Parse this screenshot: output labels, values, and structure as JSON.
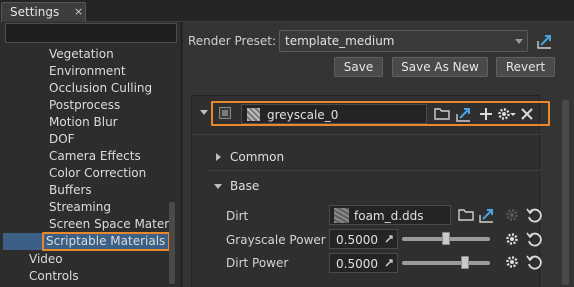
{
  "window": {
    "tab_title": "Settings",
    "tab_close": "×"
  },
  "left_panel": {
    "search_value": "",
    "tree": [
      {
        "label": "Vegetation",
        "level": 1
      },
      {
        "label": "Environment",
        "level": 1
      },
      {
        "label": "Occlusion Culling",
        "level": 1
      },
      {
        "label": "Postprocess",
        "level": 1
      },
      {
        "label": "Motion Blur",
        "level": 1
      },
      {
        "label": "DOF",
        "level": 1
      },
      {
        "label": "Camera Effects",
        "level": 1
      },
      {
        "label": "Color Correction",
        "level": 1
      },
      {
        "label": "Buffers",
        "level": 1
      },
      {
        "label": "Streaming",
        "level": 1
      },
      {
        "label": "Screen Space Mater...",
        "level": 1
      },
      {
        "label": "Scriptable Materials",
        "level": 1,
        "selected": true
      },
      {
        "label": "Video",
        "level": 0
      },
      {
        "label": "Controls",
        "level": 0
      }
    ]
  },
  "right_panel": {
    "render_preset_label": "Render Preset:",
    "render_preset_value": "template_medium",
    "buttons": {
      "save": "Save",
      "save_as_new": "Save As New",
      "revert": "Revert"
    },
    "material": {
      "name": "greyscale_0",
      "enabled": false,
      "groups": {
        "common": "Common",
        "base": "Base"
      },
      "params": {
        "dirt_label": "Dirt",
        "dirt_value": "foam_d.dds",
        "grayscale_power_label": "Grayscale Power",
        "grayscale_power_value": "0.5000",
        "grayscale_power_level": 0.5,
        "dirt_power_label": "Dirt Power",
        "dirt_power_value": "0.5000",
        "dirt_power_level": 0.74
      }
    }
  },
  "colors": {
    "highlight_orange": "#e8872b",
    "selection_blue": "#3c5f85",
    "accent_blue": "#4aa3e0"
  },
  "icons": [
    "close-icon",
    "dropdown-arrow-icon",
    "share-arrow-icon",
    "folder-icon",
    "plus-icon",
    "gear-icon",
    "reset-icon",
    "picker-icon"
  ]
}
